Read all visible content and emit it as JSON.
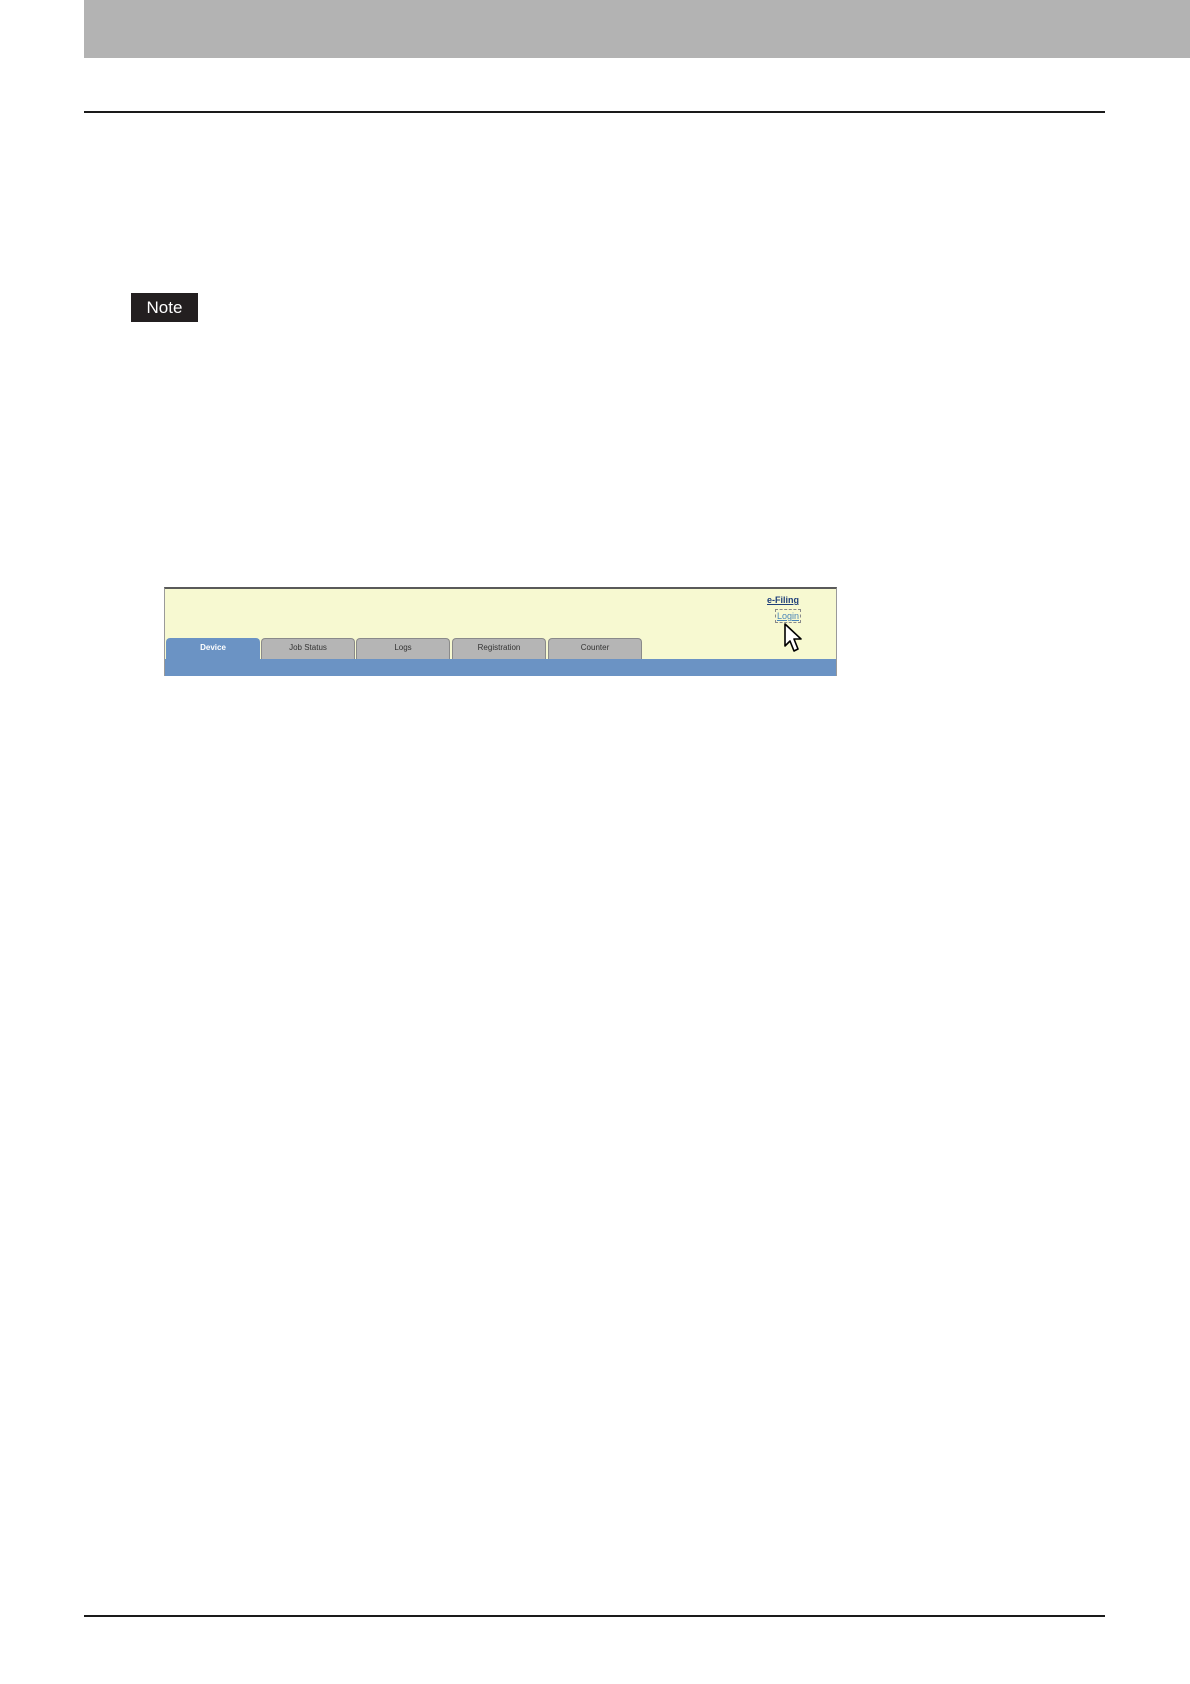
{
  "page": {
    "note_label": "Note"
  },
  "screenshot": {
    "links": {
      "efiling": "e-Filing",
      "login": "Login"
    },
    "tabs": [
      {
        "label": "Device",
        "active": true
      },
      {
        "label": "Job Status",
        "active": false
      },
      {
        "label": "Logs",
        "active": false
      },
      {
        "label": "Registration",
        "active": false
      },
      {
        "label": "Counter",
        "active": false
      }
    ],
    "colors": {
      "header_background": "#f7f9d1",
      "tab_bar": "#6b93c4",
      "inactive_tab": "#b5b5b5"
    },
    "cursor_icon": "arrow-cursor-icon"
  }
}
